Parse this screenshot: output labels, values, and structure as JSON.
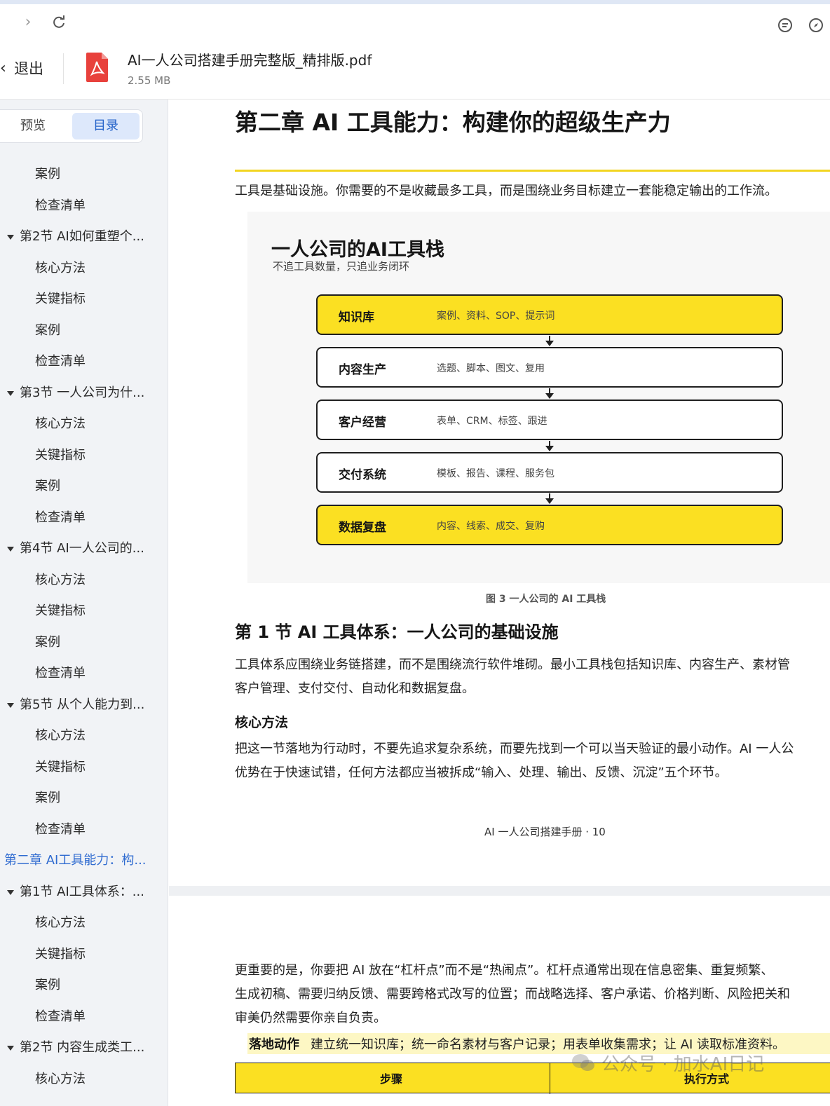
{
  "browser": {
    "forward_icon": "chevron-right-icon",
    "reload_icon": "reload-icon",
    "right_icons": [
      "comment-icon",
      "compass-icon"
    ]
  },
  "header": {
    "back_label": "退出",
    "file_name": "AI一人公司搭建手册完整版_精排版.pdf",
    "file_size": "2.55 MB"
  },
  "sidebar": {
    "tabs": [
      "预览",
      "目录"
    ],
    "active_tab": "目录",
    "items": [
      {
        "level": 2,
        "label": "案例"
      },
      {
        "level": 2,
        "label": "检查清单"
      },
      {
        "level": 1,
        "label": "第2节 AI如何重塑个..."
      },
      {
        "level": 2,
        "label": "核心方法"
      },
      {
        "level": 2,
        "label": "关键指标"
      },
      {
        "level": 2,
        "label": "案例"
      },
      {
        "level": 2,
        "label": "检查清单"
      },
      {
        "level": 1,
        "label": "第3节 一人公司为什..."
      },
      {
        "level": 2,
        "label": "核心方法"
      },
      {
        "level": 2,
        "label": "关键指标"
      },
      {
        "level": 2,
        "label": "案例"
      },
      {
        "level": 2,
        "label": "检查清单"
      },
      {
        "level": 1,
        "label": "第4节 AI一人公司的..."
      },
      {
        "level": 2,
        "label": "核心方法"
      },
      {
        "level": 2,
        "label": "关键指标"
      },
      {
        "level": 2,
        "label": "案例"
      },
      {
        "level": 2,
        "label": "检查清单"
      },
      {
        "level": 1,
        "label": "第5节 从个人能力到..."
      },
      {
        "level": 2,
        "label": "核心方法"
      },
      {
        "level": 2,
        "label": "关键指标"
      },
      {
        "level": 2,
        "label": "案例"
      },
      {
        "level": 2,
        "label": "检查清单"
      },
      {
        "level": 0,
        "label": "第二章 AI工具能力：构..."
      },
      {
        "level": 1,
        "label": "第1节 AI工具体系：..."
      },
      {
        "level": 2,
        "label": "核心方法"
      },
      {
        "level": 2,
        "label": "关键指标"
      },
      {
        "level": 2,
        "label": "案例"
      },
      {
        "level": 2,
        "label": "检查清单"
      },
      {
        "level": 1,
        "label": "第2节 内容生成类工..."
      },
      {
        "level": 2,
        "label": "核心方法"
      }
    ]
  },
  "page1": {
    "chapter_title": "第二章  AI 工具能力：构建你的超级生产力",
    "intro": "工具是基础设施。你需要的不是收藏最多工具，而是围绕业务目标建立一套能稳定输出的工作流。",
    "figure": {
      "title": "一人公司的AI工具栈",
      "subtitle": "不追工具数量，只追业务闭环",
      "stack": [
        {
          "name": "知识库",
          "desc": "案例、资料、SOP、提示词",
          "highlight": true
        },
        {
          "name": "内容生产",
          "desc": "选题、脚本、图文、复用",
          "highlight": false
        },
        {
          "name": "客户经营",
          "desc": "表单、CRM、标签、跟进",
          "highlight": false
        },
        {
          "name": "交付系统",
          "desc": "模板、报告、课程、服务包",
          "highlight": false
        },
        {
          "name": "数据复盘",
          "desc": "内容、线索、成交、复购",
          "highlight": true
        }
      ],
      "highlight_color": "#fbe022"
    },
    "caption": "图 3  一人公司的 AI 工具栈",
    "section_title": "第 1 节  AI 工具体系：一人公司的基础设施",
    "section_para": [
      "工具体系应围绕业务链搭建，而不是围绕流行软件堆砌。最小工具栈包括知识库、内容生产、素材管",
      "客户管理、支付交付、自动化和数据复盘。"
    ],
    "method_title": "核心方法",
    "method_para": [
      "把这一节落地为行动时，不要先追求复杂系统，而要先找到一个可以当天验证的最小动作。AI 一人公",
      "优势在于快速试错，任何方法都应当被拆成“输入、处理、输出、反馈、沉淀”五个环节。"
    ],
    "footer": "AI 一人公司搭建手册  ·  10"
  },
  "page2": {
    "para": [
      "更重要的是，你要把 AI 放在“杠杆点”而不是“热闹点”。杠杆点通常出现在信息密集、重复频繁、",
      "生成初稿、需要归纳反馈、需要跨格式改写的位置；而战略选择、客户承诺、价格判断、风险把关和",
      "审美仍然需要你亲自负责。"
    ],
    "action_label": "落地动作",
    "action_text": "建立统一知识库；统一命名素材与客户记录；用表单收集需求；让 AI 读取标准资料。",
    "table_headers": [
      "步骤",
      "执行方式"
    ]
  },
  "watermark": "公众号 · 加水AI日记"
}
